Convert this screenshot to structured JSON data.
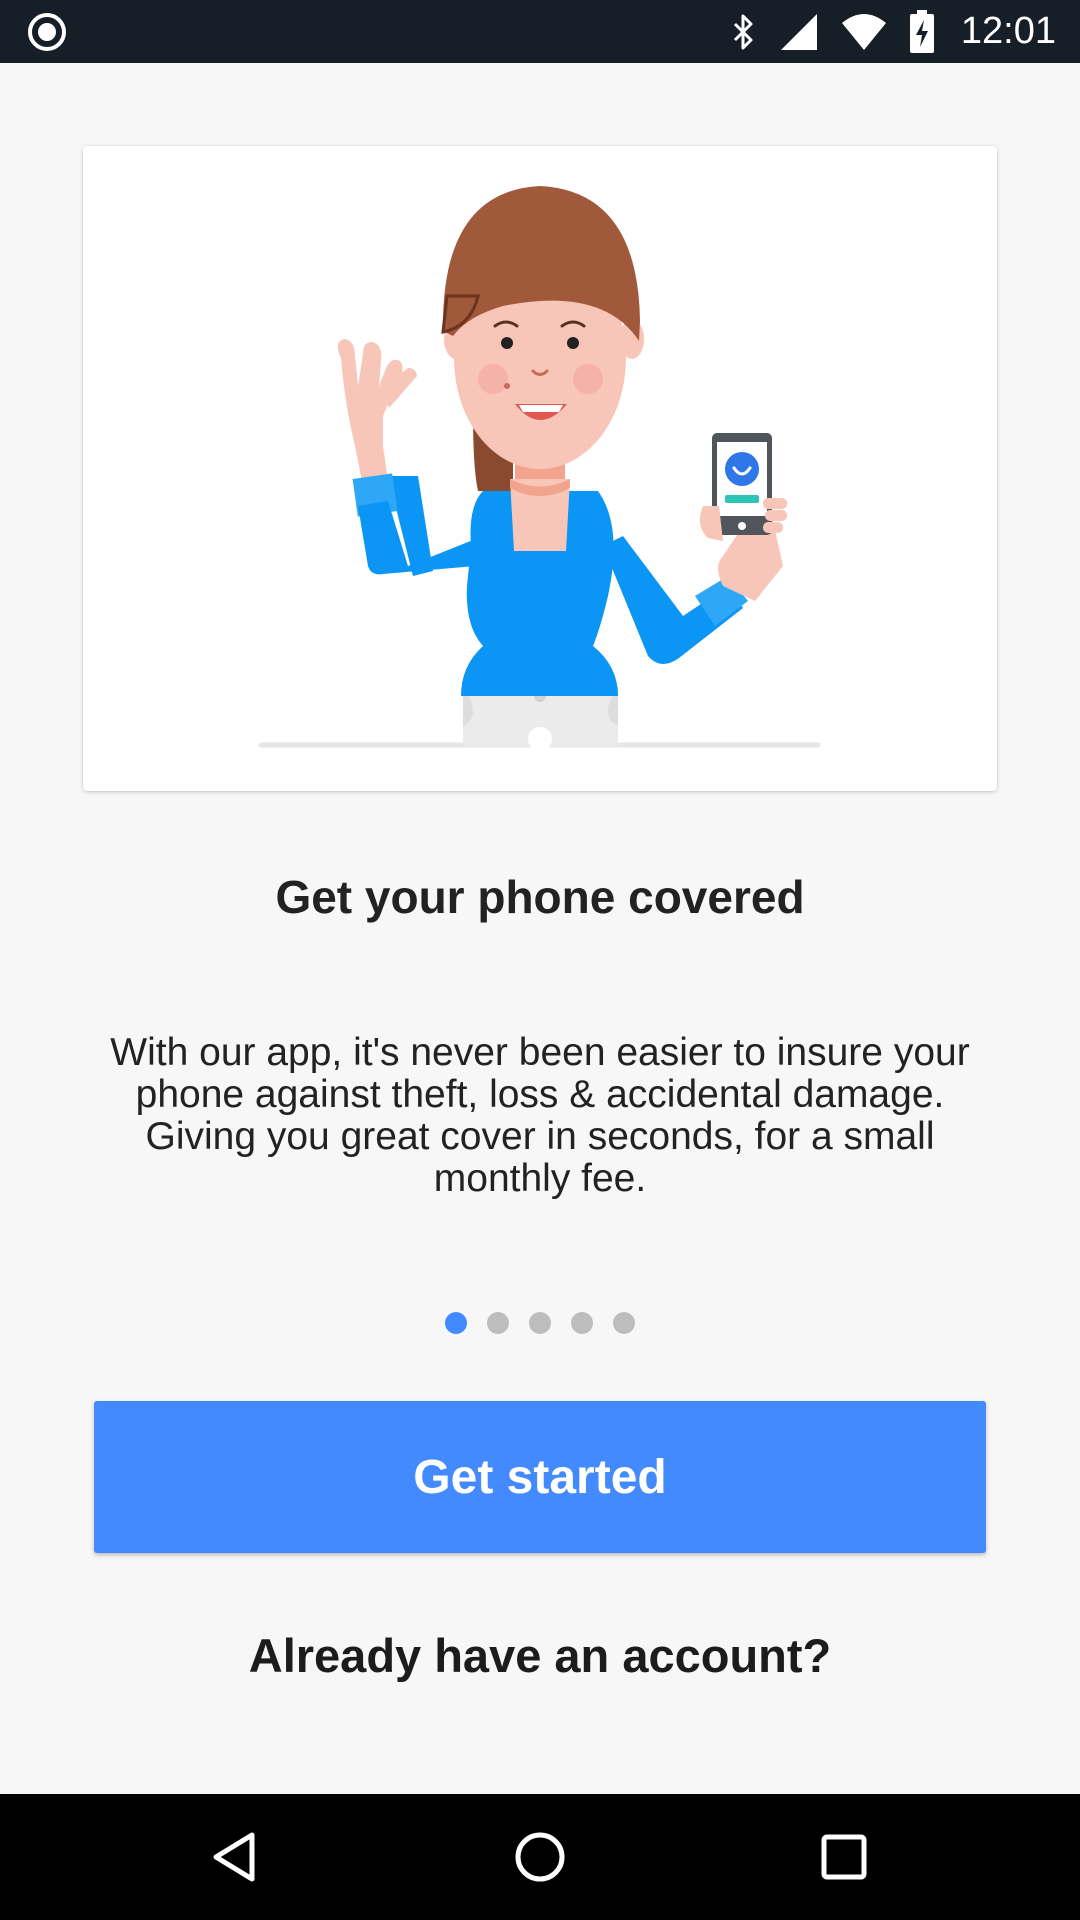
{
  "status_bar": {
    "time": "12:01",
    "icons": [
      "record-icon",
      "bluetooth-icon",
      "signal-icon",
      "wifi-icon",
      "battery-charging-icon"
    ]
  },
  "onboarding": {
    "illustration": "woman-waving-with-phone",
    "title": "Get your phone covered",
    "description": "With our app, it's never been easier to insure your phone against theft, loss & accidental damage. Giving you great cover in seconds, for a small monthly fee.",
    "page_indicator": {
      "count": 5,
      "active": 1
    }
  },
  "actions": {
    "primary_label": "Get started",
    "secondary_label": "Already have an account?"
  },
  "nav_bar": {
    "icons": [
      "back-icon",
      "home-icon",
      "recents-icon"
    ]
  },
  "colors": {
    "accent": "#448aff",
    "status_bar": "#161e27",
    "background": "#f7f7f7",
    "shirt": "#0b95f5",
    "hair": "#a0593b"
  }
}
